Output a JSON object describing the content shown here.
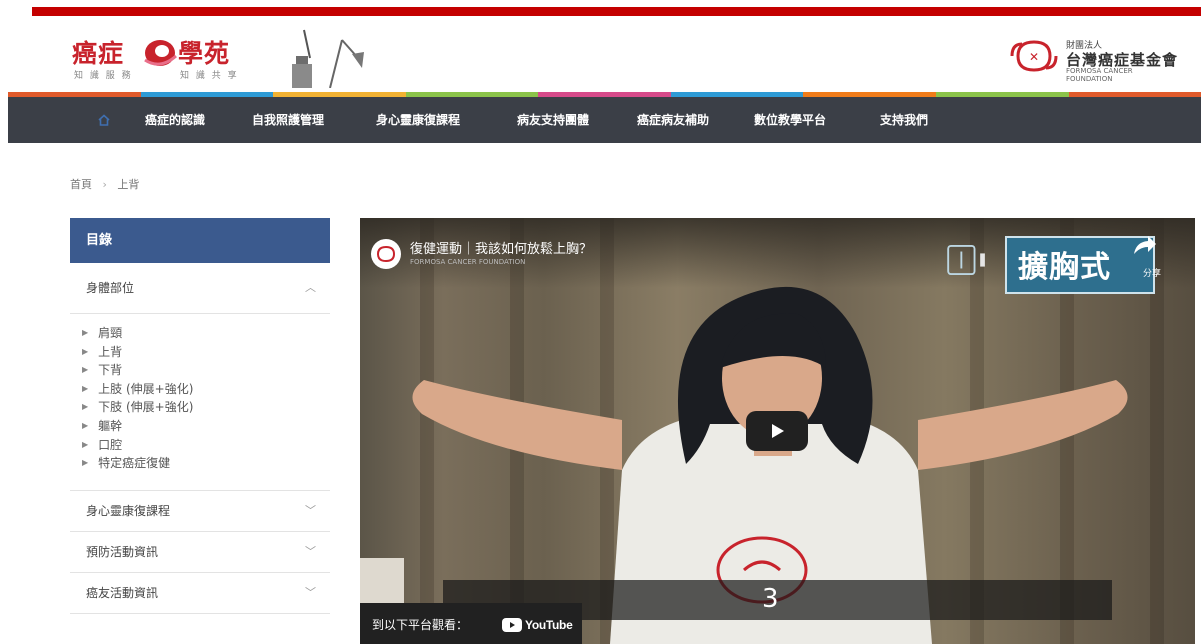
{
  "header": {
    "logo_left": "癌症",
    "logo_right": "學苑",
    "logo_left_sub": "知 識 服 務",
    "logo_right_sub": "知 識 共 享",
    "foundation_small": "財團法人",
    "foundation_name": "台灣癌症基金會",
    "foundation_en": "FORMOSA CANCER FOUNDATION",
    "strip_colors": [
      "#e05a2b",
      "#2e9bd6",
      "#f2b233",
      "#8bc34a",
      "#d64a8a",
      "#2e9bd6",
      "#f07c1a",
      "#8bc34a",
      "#e05a2b"
    ]
  },
  "nav": {
    "home_icon": "home-icon",
    "items": [
      {
        "label": "癌症的認識"
      },
      {
        "label": "自我照護管理"
      },
      {
        "label": "身心靈康復課程"
      },
      {
        "label": "病友支持團體"
      },
      {
        "label": "癌症病友補助"
      },
      {
        "label": "數位教學平台"
      },
      {
        "label": "支持我們"
      }
    ]
  },
  "breadcrumb": {
    "home": "首頁",
    "separator": "›",
    "current": "上背"
  },
  "sidebar": {
    "header": "目錄",
    "section_body": "身體部位",
    "body_parts": [
      "肩頸",
      "上背",
      "下背",
      "上肢 (伸展+強化)",
      "下肢 (伸展+強化)",
      "軀幹",
      "口腔",
      "特定癌症復健"
    ],
    "sections": [
      {
        "label": "身心靈康復課程"
      },
      {
        "label": "預防活動資訊"
      },
      {
        "label": "癌友活動資訊"
      }
    ]
  },
  "video": {
    "title": "復健運動｜我該如何放鬆上胸？",
    "channel": "FORMOSA CANCER FOUNDATION",
    "share_label": "分享",
    "sign_text": "擴胸式",
    "caption": "3",
    "watch_on": "到以下平台觀看：",
    "platform": "YouTube"
  }
}
